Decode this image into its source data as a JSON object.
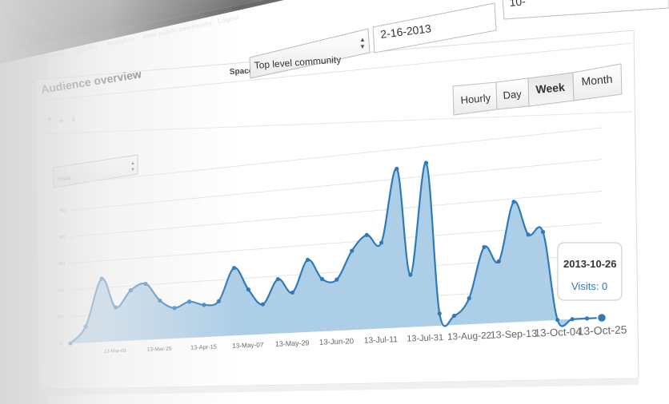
{
  "app_nav": {
    "items": [
      "Home",
      "Content",
      "Updates",
      "Analytics",
      "View public community",
      "Logout"
    ]
  },
  "panel": {
    "title": "Audience overview",
    "space_label": "Space:",
    "space_value": "Top level community",
    "date_from": "2-16-2013",
    "date_to": "10-"
  },
  "granularity": {
    "options": [
      "Hourly",
      "Day",
      "Week",
      "Month"
    ],
    "selected": "Week"
  },
  "metric_select": {
    "value": "Visits"
  },
  "tooltip": {
    "date": "2013-10-26",
    "visits_label": "Visits: 0"
  },
  "chart_data": {
    "type": "area",
    "title": "",
    "xlabel": "",
    "ylabel": "",
    "series": [
      {
        "name": "Visits",
        "values": [
          0,
          60,
          235,
          125,
          185,
          205,
          140,
          110,
          130,
          115,
          125,
          240,
          160,
          105,
          190,
          140,
          250,
          180,
          175,
          270,
          320,
          290,
          535,
          175,
          545,
          40,
          30,
          85,
          250,
          200,
          390,
          280,
          285,
          0,
          0,
          0,
          0
        ]
      }
    ],
    "tick_labels": [
      "13-Mar-03",
      "13-Mar-25",
      "13-Apr-15",
      "13-May-07",
      "13-May-29",
      "13-Jun-20",
      "13-Jul-11",
      "13-Jul-31",
      "13-Aug-22",
      "13-Sep-13",
      "13-Oct-04",
      "13-Oct-25"
    ],
    "y_ticks": [
      "0",
      "100",
      "200",
      "300",
      "400",
      "500"
    ],
    "ylim": [
      0,
      600
    ],
    "grid": true,
    "color": "#2f7ab8",
    "fill": "#a9cbe6"
  }
}
